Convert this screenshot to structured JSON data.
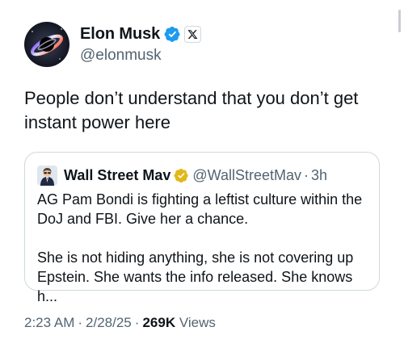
{
  "author": {
    "display_name": "Elon Musk",
    "handle": "@elonmusk",
    "verified_color": "#1d9bf0"
  },
  "tweet": {
    "text_line_1": "People don’t understand that you don’t get",
    "text_line_2": "instant power here"
  },
  "quoted_tweet": {
    "display_name": "Wall Street Mav",
    "handle": "@WallStreetMav",
    "dot": "·",
    "time": "3h",
    "verified_color": "#e2b719",
    "paragraph_1_line_1": "AG Pam Bondi is fighting a leftist culture within the",
    "paragraph_1_line_2": "DoJ and FBI. Give her a chance.",
    "paragraph_2_line_1": "She is not hiding anything, she is not covering up",
    "paragraph_2_line_2": "Epstein. She wants the info released. She knows h..."
  },
  "meta": {
    "time": "2:23 AM",
    "dot1": "·",
    "date": "2/28/25",
    "dot2": "·",
    "views_count": "269K",
    "views_label": "Views"
  },
  "icons": {
    "verified": "verified-badge-icon",
    "x_logo": "x-logo-icon"
  }
}
